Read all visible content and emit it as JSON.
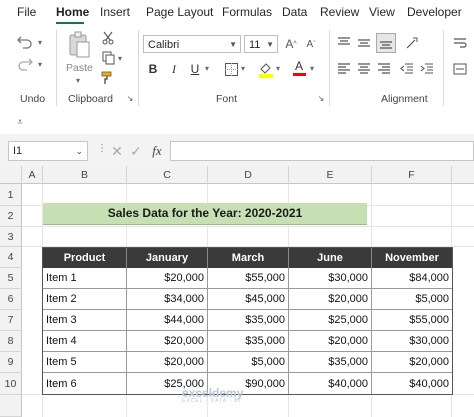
{
  "menu": {
    "tabs": [
      "File",
      "Home",
      "Insert",
      "Page Layout",
      "Formulas",
      "Data",
      "Review",
      "View",
      "Developer"
    ],
    "active": "Home"
  },
  "ribbon": {
    "groups": {
      "undo": "Undo",
      "clipboard": "Clipboard",
      "font": "Font",
      "alignment": "Alignment"
    },
    "paste_label": "Paste",
    "font_name": "Calibri",
    "font_size": "11",
    "bold": "B",
    "italic": "I",
    "underline": "U",
    "grow_font": "A",
    "shrink_font": "A",
    "font_color_letter": "A",
    "highlight_color": "#ffff00",
    "font_color": "#ff0000"
  },
  "formula_bar": {
    "name_box": "I1",
    "fx_label": "fx",
    "formula": ""
  },
  "sheet": {
    "columns": [
      "A",
      "B",
      "C",
      "D",
      "E",
      "F"
    ],
    "rows": [
      "1",
      "2",
      "3",
      "4",
      "5",
      "6",
      "7",
      "8",
      "9",
      "10"
    ],
    "title": "Sales Data for the Year: 2020-2021",
    "title_fill": "#c6e0b4",
    "header_fill": "#3a3a3a",
    "headers": [
      "Product",
      "January",
      "March",
      "June",
      "November"
    ],
    "data": [
      [
        "Item 1",
        "$20,000",
        "$55,000",
        "$30,000",
        "$84,000"
      ],
      [
        "Item 2",
        "$34,000",
        "$45,000",
        "$20,000",
        "$5,000"
      ],
      [
        "Item 3",
        "$44,000",
        "$35,000",
        "$25,000",
        "$55,000"
      ],
      [
        "Item 4",
        "$20,000",
        "$35,000",
        "$20,000",
        "$30,000"
      ],
      [
        "Item 5",
        "$20,000",
        "$5,000",
        "$35,000",
        "$20,000"
      ],
      [
        "Item 6",
        "$25,000",
        "$90,000",
        "$40,000",
        "$40,000"
      ]
    ]
  },
  "watermark": {
    "name": "exceldemy",
    "tagline": "EXCEL · DATA · BI"
  }
}
